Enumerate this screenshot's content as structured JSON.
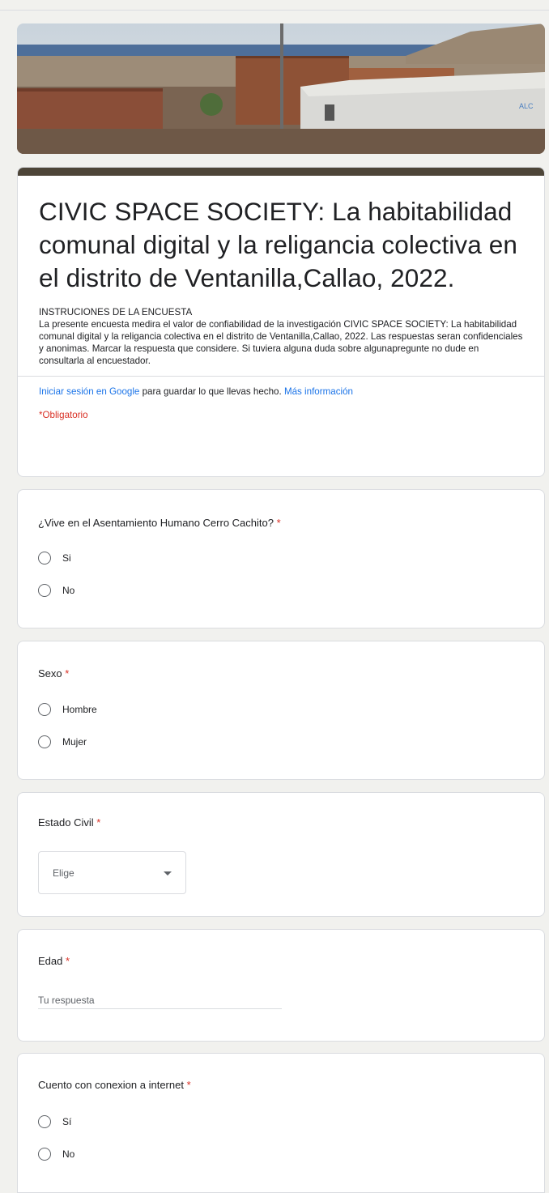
{
  "form": {
    "title": "CIVIC SPACE SOCIETY: La habitabilidad comunal digital y la religancia colectiva en el distrito de Ventanilla,Callao, 2022.",
    "instructions_heading": "INSTRUCIONES DE LA ENCUESTA",
    "instructions_body": "La presente encuesta medira el valor de confiabilidad de la investigación CIVIC SPACE SOCIETY: La habitabilidad comunal digital y la religancia colectiva en el distrito de Ventanilla,Callao, 2022. Las respuestas seran confidenciales y anonimas. Marcar la respuesta que considere. Si tuviera alguna duda sobre algunapregunte no dude en consultarla al encuestador.",
    "signin_link": "Iniciar sesión en Google",
    "signin_text": " para guardar lo que llevas hecho. ",
    "more_info_link": "Más información",
    "required_note": "*Obligatorio"
  },
  "questions": {
    "q1": {
      "label": "¿Vive en el Asentamiento Humano Cerro Cachito?",
      "star": "*",
      "options": [
        "Si",
        "No"
      ]
    },
    "q2": {
      "label": "Sexo",
      "star": "*",
      "options": [
        "Hombre",
        "Mujer"
      ]
    },
    "q3": {
      "label": "Estado Civil",
      "star": "*",
      "select_value": "Elige"
    },
    "q4": {
      "label": "Edad",
      "star": "*",
      "placeholder": "Tu respuesta"
    },
    "q5": {
      "label": "Cuento con conexion a internet",
      "star": "*",
      "options": [
        "Sí",
        "No"
      ]
    }
  },
  "colors": {
    "accent": "#4d4538",
    "required": "#d93025",
    "link": "#1a73e8"
  }
}
